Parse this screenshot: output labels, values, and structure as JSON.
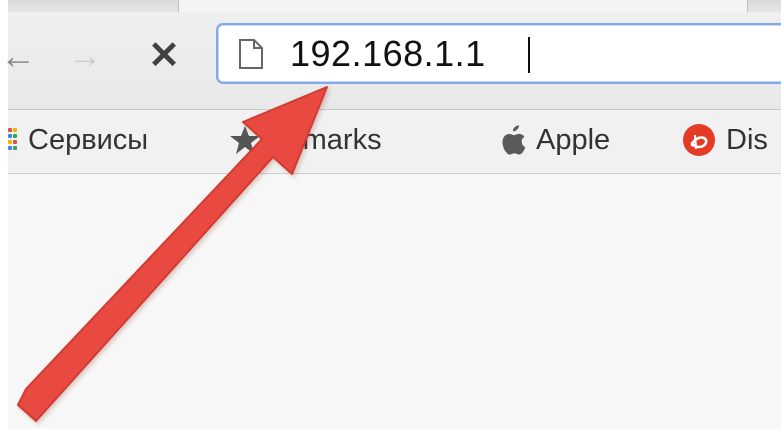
{
  "toolbar": {
    "back_icon": "back-arrow-icon",
    "forward_icon": "forward-arrow-icon",
    "stop_icon": "stop-icon",
    "back_glyph": "←",
    "forward_glyph": "→",
    "stop_glyph": "✕"
  },
  "omnibox": {
    "url": "192.168.1.1",
    "icon": "page-icon"
  },
  "bookmarks": {
    "items": [
      {
        "label": "Сервисы",
        "icon": "apps-icon"
      },
      {
        "label": "okmarks",
        "icon": "star-icon"
      },
      {
        "label": "Apple",
        "icon": "apple-icon"
      },
      {
        "label": "Dis",
        "icon": "disney-icon"
      }
    ]
  },
  "colors": {
    "annotation_arrow": "#e84a3f",
    "omnibox_border": "#84a7ea",
    "disney_red": "#e53a25"
  }
}
